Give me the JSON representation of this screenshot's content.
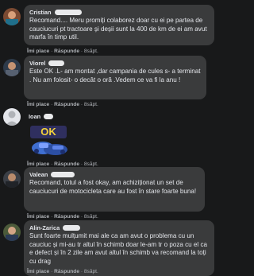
{
  "comments": [
    {
      "author": "Cristian",
      "text": "Recomand.... Meru promiți colaborez doar cu ei pe partea de cauciucuri pt tractoare și deșii sunt la 400 de km de ei am avut marfa în timp util.",
      "like": "Îmi place",
      "reply": "Răspunde",
      "time": "8săpt."
    },
    {
      "author": "Viorel",
      "text": "Este OK .L- am montat ,dar campania de cules s- a terminat . Nu am folosit- o decât o oră .Vedem ce va fi la anu !",
      "like": "Îmi place",
      "reply": "Răspunde",
      "time": "8săpt."
    },
    {
      "author": "Ioan",
      "sticker_text": "OK",
      "like": "Îmi place",
      "reply": "Răspunde",
      "time": "8săpt."
    },
    {
      "author": "Valean",
      "text": "Recomand, totul a fost okay, am achiziționat un set de cauciucuri de motocicleta care au fost în stare foarte buna!",
      "like": "Îmi place",
      "reply": "Răspunde",
      "time": "8săpt."
    },
    {
      "author": "Alin-Zarica",
      "text": "Sunt foarte mulțumit mai ale ca am avut o problema cu un cauciuc și mi-au tr altul în schimb doar le-am tr o poza cu el ca e defect și în 2 zile am avut altul în schimb va recomand la toți cu drag",
      "like": "Îmi place",
      "reply": "Răspunde",
      "time": "8săpt."
    }
  ],
  "colors": {
    "background": "#18191a",
    "bubble": "#3a3b3c",
    "text": "#e4e6eb",
    "meta": "#b0b3b8"
  }
}
